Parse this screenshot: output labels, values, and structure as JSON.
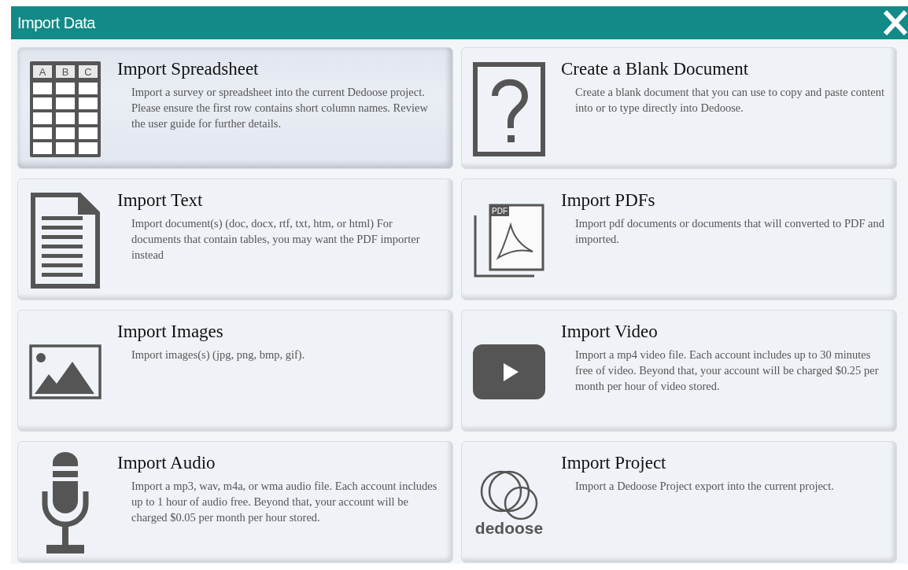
{
  "dialog": {
    "title": "Import Data"
  },
  "options": [
    {
      "kind": "spreadsheet",
      "title": "Import Spreadsheet",
      "description": "Import a survey or spreadsheet into the current Dedoose project. Please ensure the first row contains short column names. Review the user guide for further details.",
      "selected": true,
      "icon_labels": [
        "A",
        "B",
        "C"
      ]
    },
    {
      "kind": "blank",
      "title": "Create a Blank Document",
      "description": "Create a blank document that you can use to copy and paste content into or to type directly into Dedoose.",
      "selected": false
    },
    {
      "kind": "text",
      "title": "Import Text",
      "description": "Import document(s) (doc, docx, rtf, txt, htm, or html) For documents that contain tables, you may want the PDF importer instead",
      "selected": false
    },
    {
      "kind": "pdf",
      "title": "Import PDFs",
      "description": "Import pdf documents or documents that will converted to PDF and imported.",
      "selected": false,
      "icon_labels": [
        "PDF"
      ]
    },
    {
      "kind": "images",
      "title": "Import Images",
      "description": "Import images(s) (jpg, png, bmp, gif).",
      "selected": false
    },
    {
      "kind": "video",
      "title": "Import Video",
      "description": "Import a mp4 video file. Each account includes up to 30 minutes free of video. Beyond that, your account will be charged $0.25 per month per hour of video stored.",
      "selected": false
    },
    {
      "kind": "audio",
      "title": "Import Audio",
      "description": "Import a mp3, wav, m4a, or wma audio file. Each account includes up to 1 hour of audio free. Beyond that, your account will be charged $0.05 per month per hour stored.",
      "selected": false
    },
    {
      "kind": "project",
      "title": "Import Project",
      "description": "Import a Dedoose Project export into the current project.",
      "selected": false,
      "icon_labels": [
        "dedoose"
      ]
    }
  ]
}
